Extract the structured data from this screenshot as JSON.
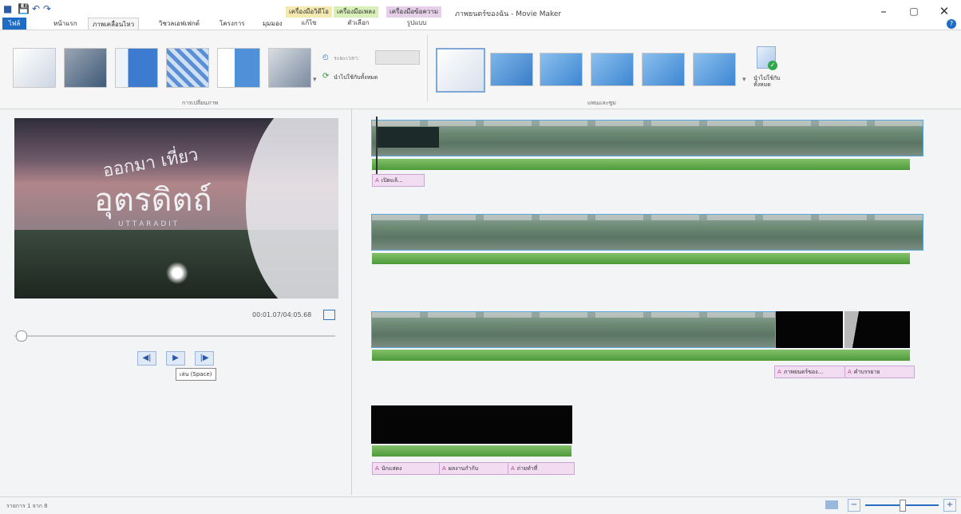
{
  "window": {
    "title": "ภาพยนตร์ของฉัน - Movie Maker",
    "minimize_icon": "–",
    "restore_icon": "▢",
    "close_icon": "✕"
  },
  "qat": {
    "icons": [
      "■",
      "💾",
      "↶",
      "↷"
    ]
  },
  "context_tabs": [
    {
      "label": "เครื่องมือวิดีโอ",
      "color": "#f4eab0",
      "sub": "แก้ไข"
    },
    {
      "label": "เครื่องมือเพลง",
      "color": "#d8efb8",
      "sub": "ตัวเลือก"
    },
    {
      "label": "เครื่องมือข้อความ",
      "color": "#e6cfe9",
      "sub": "รูปแบบ"
    }
  ],
  "tabs": {
    "file": "ไฟล์",
    "home": "หน้าแรก",
    "animation": "ภาพเคลื่อนไหว",
    "visual_effects": "วิชวลเอฟเฟกต์",
    "project": "โครงการ",
    "view": "มุมมอง"
  },
  "ribbon": {
    "transitions_label": "การเปลี่ยนภาพ",
    "duration_label": "ระยะเวลา:",
    "apply_all_label": "นำไปใช้กับทั้งหมด",
    "panzoom_label": "แพนและซูม",
    "apply_all_button": "นำไปใช้กับทั้งหมด"
  },
  "preview": {
    "title_line1": "ออกมา เที่ยว",
    "title_line2": "อุตรดิตถ์",
    "subtitle": "U T T A R A D I T",
    "timecode": "00:01.07/04:05.68",
    "playback_position": 0.004
  },
  "playback": {
    "prev_icon": "◀|",
    "play_icon": "▶",
    "next_icon": "|▶",
    "tooltip": "เล่น (Space)"
  },
  "storyboard": {
    "row1_caption": "เปิดแล้...",
    "row3_captions": [
      "ภาพยนตร์ของ...",
      "คำบรรยาย"
    ],
    "row4_captions": [
      "นักแสดง",
      "ผลงานกำกับ",
      "ถ่ายทำที่"
    ],
    "caption_icon": "A"
  },
  "statusbar": {
    "item_count": "รายการ 1 จาก 8",
    "zoom_minus": "−",
    "zoom_plus": "+",
    "zoom_level": 0.5
  }
}
